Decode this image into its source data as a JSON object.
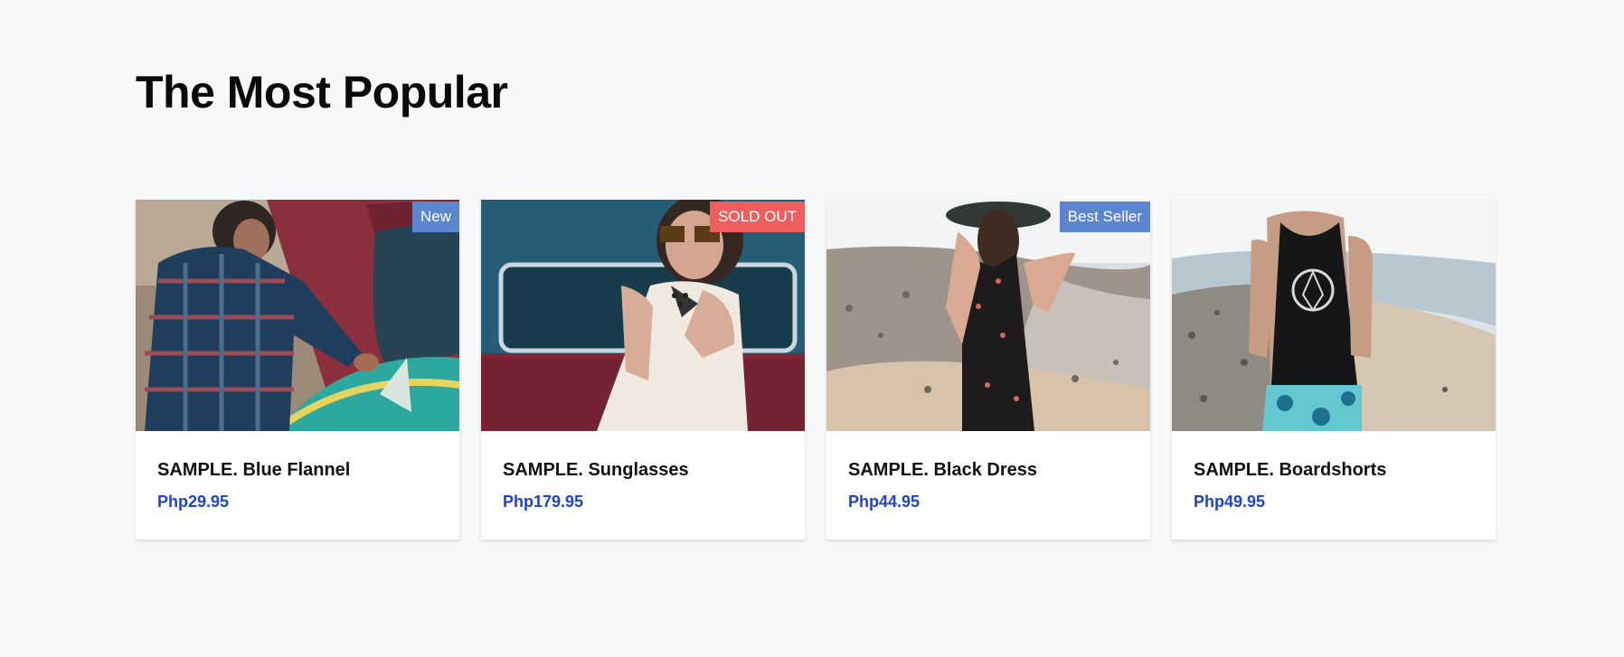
{
  "section": {
    "title": "The Most Popular"
  },
  "products": [
    {
      "name": "SAMPLE. Blue Flannel",
      "price": "Php29.95",
      "badge": "New",
      "badge_color": "#5b86cf",
      "image": "man-in-flannel-with-surfboard-image"
    },
    {
      "name": "SAMPLE. Sunglasses",
      "price": "Php179.95",
      "badge": "SOLD OUT",
      "badge_color": "#f05d5d",
      "image": "woman-in-sunglasses-image"
    },
    {
      "name": "SAMPLE. Black Dress",
      "price": "Php44.95",
      "badge": "Best Seller",
      "badge_color": "#5b86cf",
      "image": "woman-in-black-dress-on-beach-image"
    },
    {
      "name": "SAMPLE. Boardshorts",
      "price": "Php49.95",
      "badge": "",
      "badge_color": "",
      "image": "man-in-tank-top-on-beach-image"
    }
  ],
  "colors": {
    "page_background": "#f7f8fa",
    "price": "#1f45c4",
    "card_background": "#ffffff"
  }
}
